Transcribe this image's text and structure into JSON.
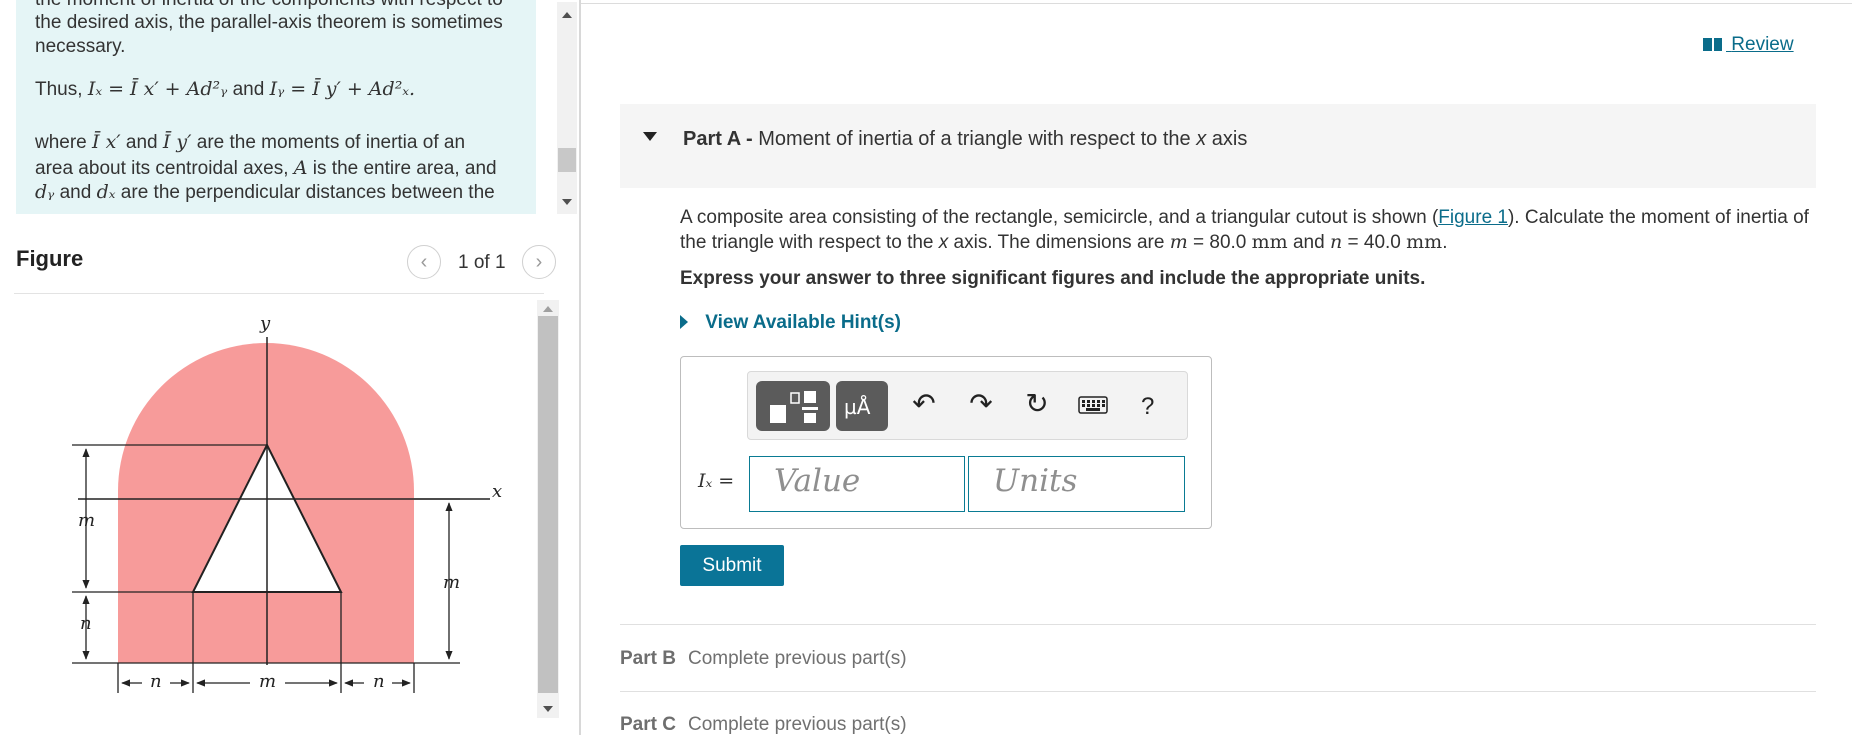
{
  "intro": {
    "line_cut": "the moment of inertia of the components with respect to",
    "line1": "the desired axis, the parallel-axis theorem is sometimes",
    "line2": "necessary.",
    "thus_label": "Thus,",
    "formula_ix": "Iₓ = Ī x′ + Ad²ᵧ",
    "and_label": "and",
    "formula_iy": "Iᵧ = Ī y′ + Ad²ₓ.",
    "where_label": "where",
    "ixbar": "Ī x′",
    "iybar": "Ī y′",
    "where_rest": "are the moments of inertia of an",
    "line_area": "area about its centroidal axes,",
    "sym_A": "A",
    "line_area_rest": "is the entire area, and",
    "sym_dy": "dᵧ",
    "sym_dx": "dₓ",
    "line_dist_rest": "are the perpendicular distances between the"
  },
  "figure": {
    "title": "Figure",
    "pager_text": "1 of 1",
    "prev_icon": "chevron-left-icon",
    "next_icon": "chevron-right-icon",
    "labels": {
      "y": "y",
      "x": "x",
      "m_left": "m",
      "n_left": "n",
      "m_right": "m",
      "n_bottom_left": "n",
      "m_bottom": "m",
      "n_bottom_right": "n"
    },
    "colors": {
      "shape_fill": "#f79b9a",
      "line": "#222222"
    }
  },
  "review": {
    "label": "Review",
    "icon": "book-icon"
  },
  "part_a": {
    "prefix": "Part A -",
    "title_start": "Moment of inertia of a triangle with respect to the",
    "title_axis": "x",
    "title_end": "axis",
    "problem_start": "A composite area consisting of the rectangle, semicircle, and a triangular cutout is shown (",
    "figure_link": "Figure 1",
    "problem_mid": "). Calculate the moment of inertia of the triangle with respect to the",
    "problem_axis": "x",
    "problem_dims": "axis. The dimensions are",
    "m_sym": "m",
    "m_value": "= 80.0",
    "m_unit": "mm",
    "and_label": "and",
    "n_sym": "n",
    "n_value": "= 40.0",
    "n_unit": "mm",
    "period": ".",
    "instruction": "Express your answer to three significant figures and include the appropriate units.",
    "hint_label": "View Available Hint(s)",
    "answer_label": "Iₓ =",
    "value_placeholder": "Value",
    "units_placeholder": "Units",
    "submit_label": "Submit",
    "toolbar": {
      "templates_icon": "templates-icon",
      "units_icon": "units-icon",
      "units_glyph": "µÅ",
      "undo_icon": "undo-icon",
      "redo_icon": "redo-icon",
      "reset_icon": "reset-icon",
      "keyboard_icon": "keyboard-icon",
      "help_label": "?"
    }
  },
  "parts": [
    {
      "label": "Part B",
      "status": "Complete previous part(s)"
    },
    {
      "label": "Part C",
      "status": "Complete previous part(s)"
    }
  ],
  "colors": {
    "accent": "#0a7497",
    "link": "#0a6c8a",
    "intro_bg": "#e5f5f6"
  }
}
